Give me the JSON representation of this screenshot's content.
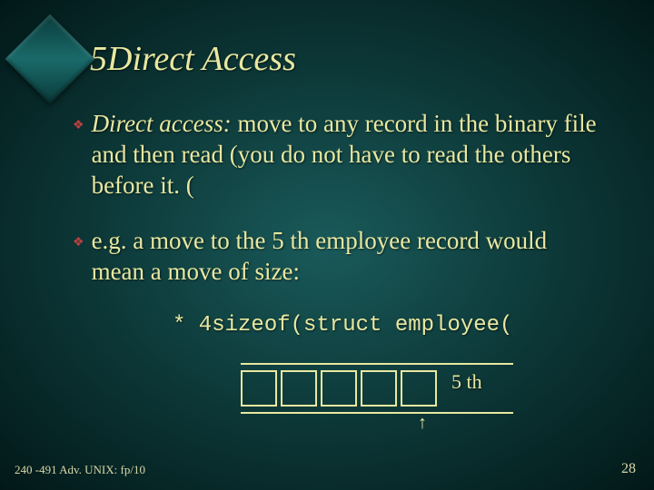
{
  "title": ". 5Direct Access",
  "bullets": [
    {
      "emph": "Direct access:",
      "rest": " move to any record in the binary file and then read (you do not have to read the others before it. ("
    },
    {
      "emph": "",
      "rest": "e.g. a move to the 5 th employee record would mean a move of size:"
    }
  ],
  "code_line": "* 4sizeof(struct employee(",
  "diagram": {
    "box_count": 5,
    "label": "5 th"
  },
  "footer": {
    "left": "240 -491 Adv. UNIX: fp/10",
    "right": "28"
  }
}
